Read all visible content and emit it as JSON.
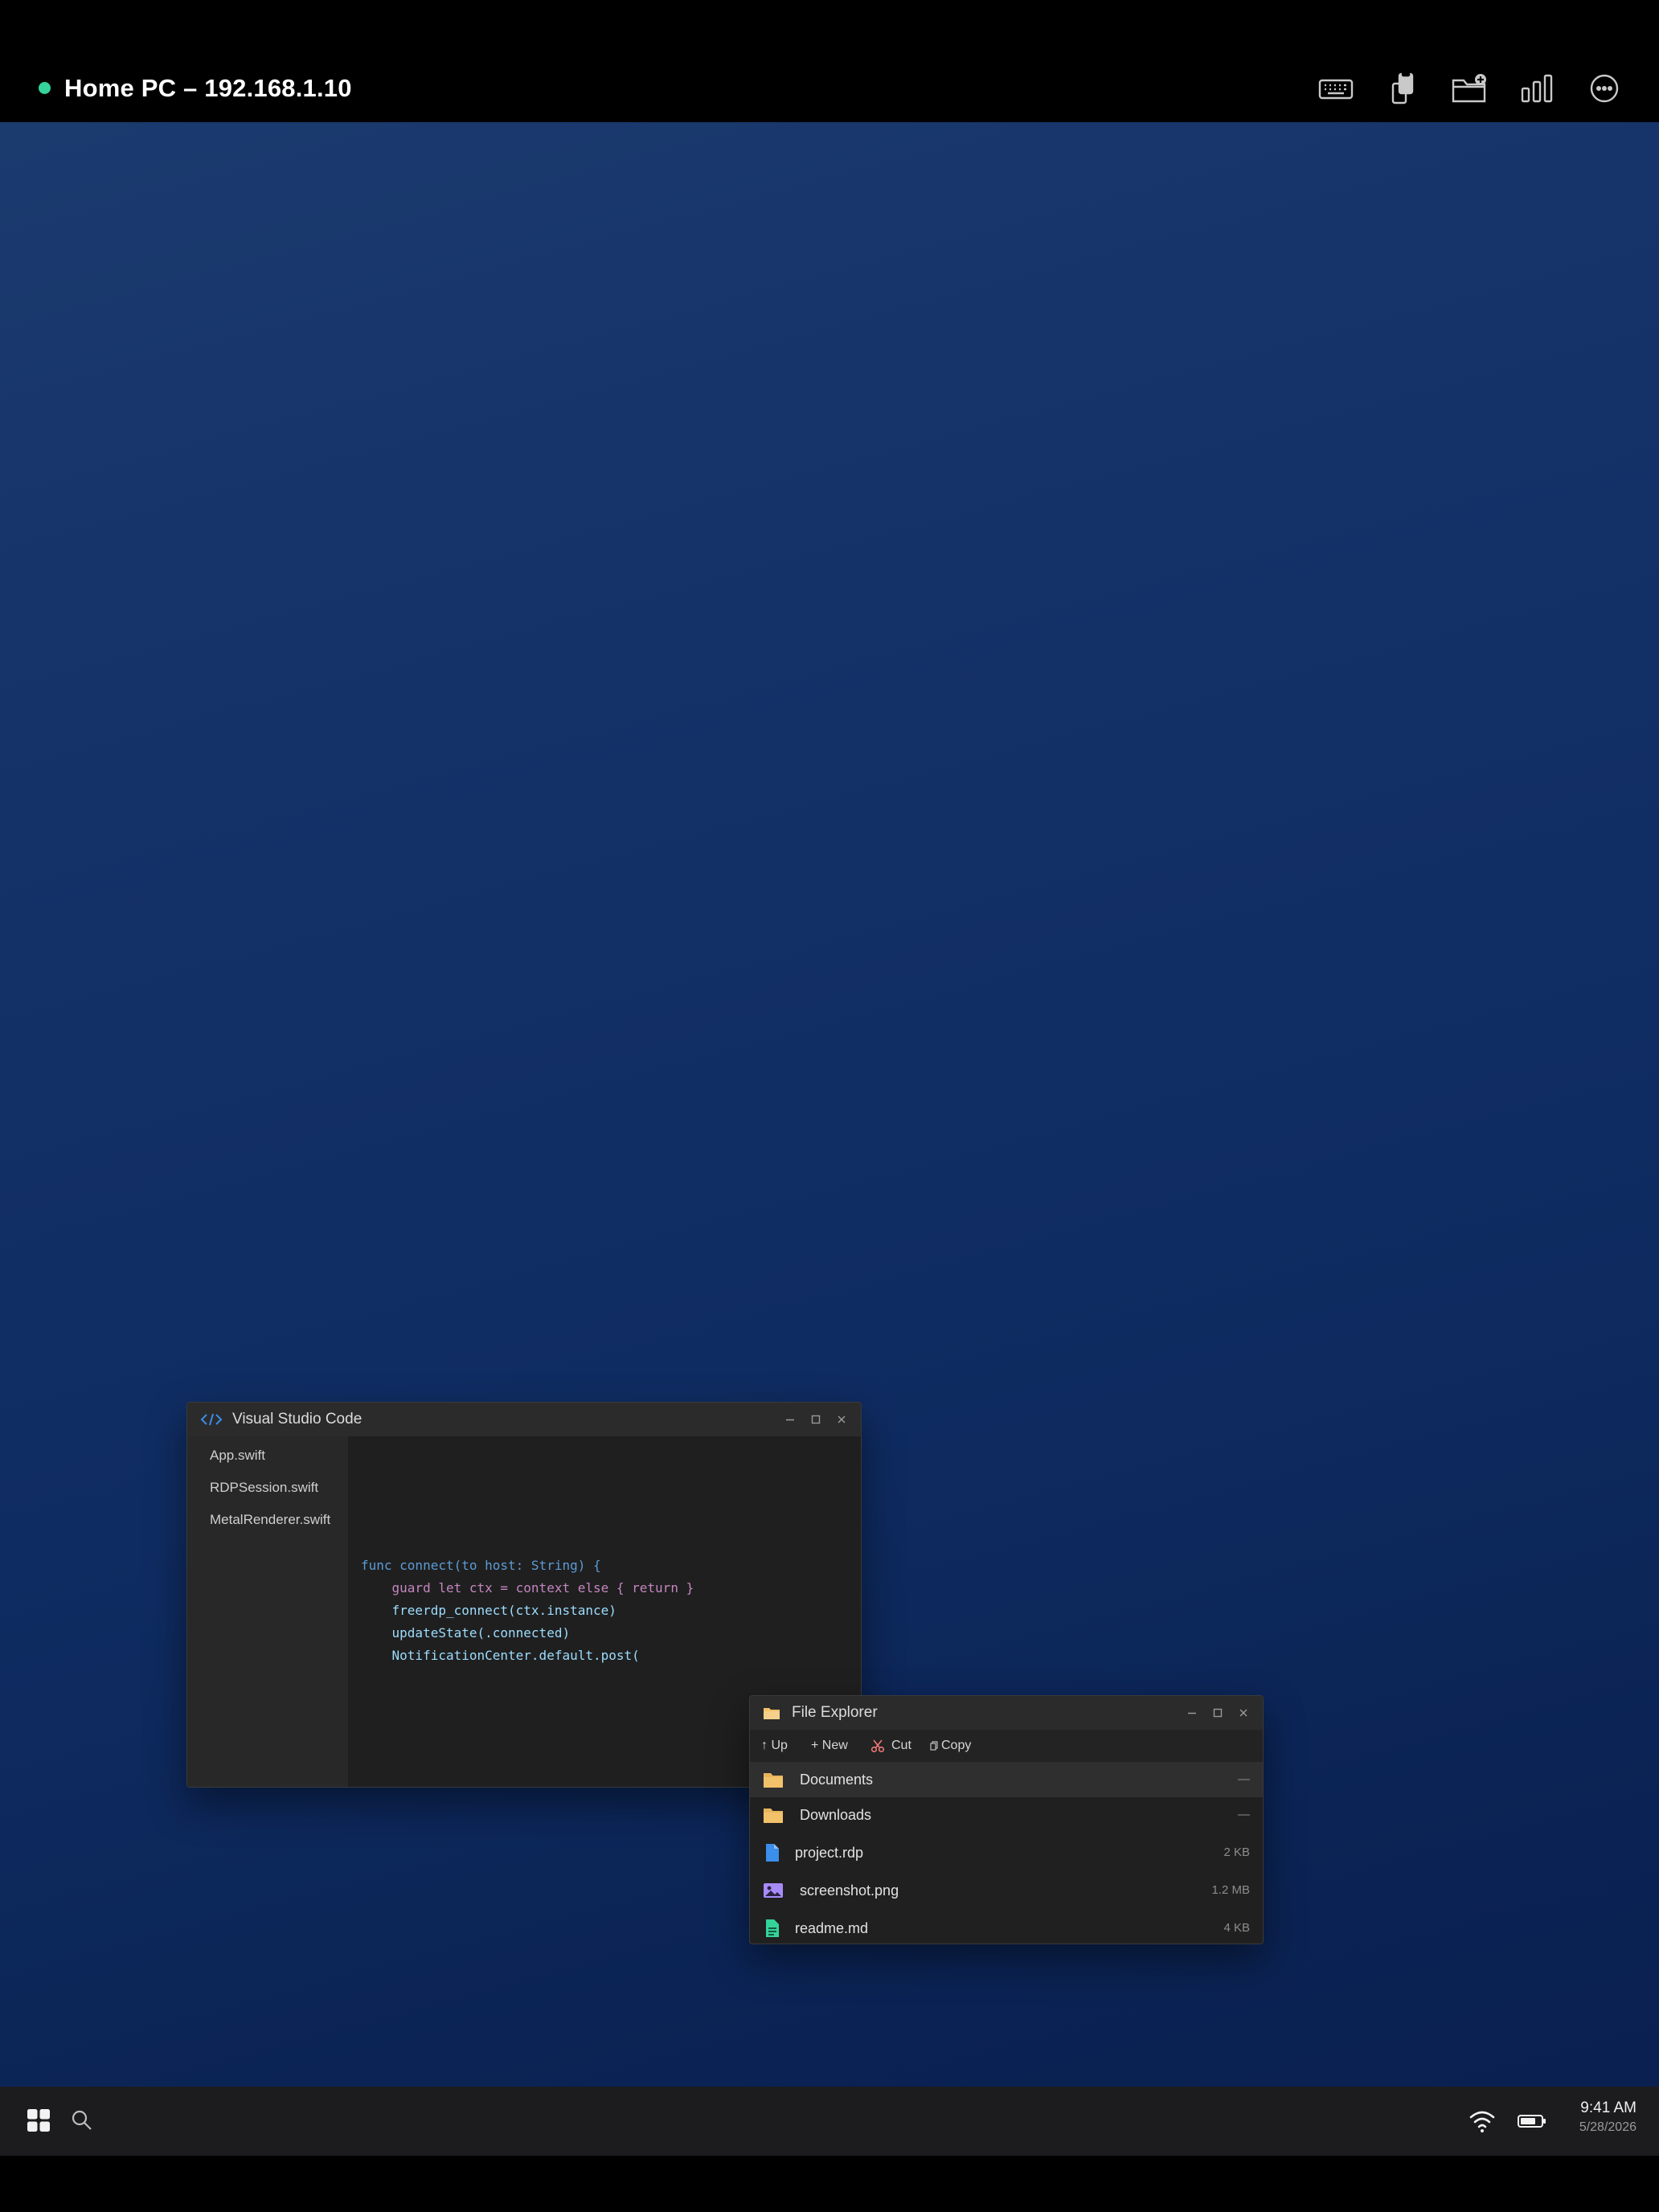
{
  "session": {
    "title": "Home PC  –  192.168.1.10",
    "status_color": "#35d39a"
  },
  "toolbar": {
    "buttons": [
      "keyboard-icon",
      "clipboard-icon",
      "shared-folder-icon",
      "stats-icon",
      "more-icon"
    ]
  },
  "vscode": {
    "title": "Visual Studio Code",
    "files": [
      "App.swift",
      "RDPSession.swift",
      "MetalRenderer.swift"
    ],
    "code": [
      "func connect(to host: String) {",
      "    guard let ctx = context else { return }",
      "    freerdp_connect(ctx.instance)",
      "    updateState(.connected)",
      "    NotificationCenter.default.post("
    ]
  },
  "explorer": {
    "title": "File Explorer",
    "toolbar": {
      "up": "↑ Up",
      "new": "+ New",
      "cut": "Cut",
      "copy": "Copy"
    },
    "rows": [
      {
        "name": "Documents",
        "size": "—",
        "type": "folder"
      },
      {
        "name": "Downloads",
        "size": "—",
        "type": "folder"
      },
      {
        "name": "project.rdp",
        "size": "2 KB",
        "type": "file"
      },
      {
        "name": "screenshot.png",
        "size": "1.2 MB",
        "type": "image"
      },
      {
        "name": "readme.md",
        "size": "4 KB",
        "type": "doc"
      }
    ]
  },
  "taskbar": {
    "time": "9:41 AM",
    "date": "5/28/2026"
  },
  "colors": {
    "accent_blue": "#3b8eea",
    "folder": "#f2c26b",
    "image_icon": "#a78bfa",
    "doc_icon": "#34d399"
  }
}
